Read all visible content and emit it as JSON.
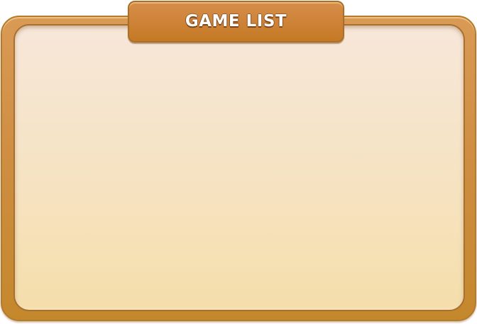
{
  "title": "GAME LIST"
}
